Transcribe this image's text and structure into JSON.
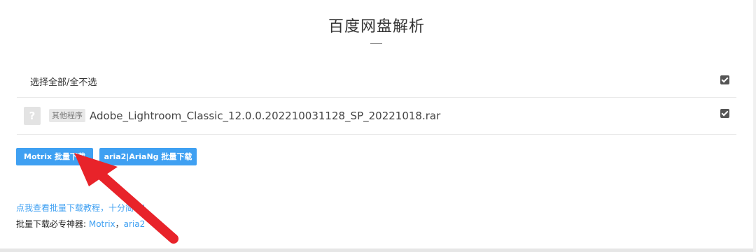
{
  "page": {
    "title": "百度网盘解析"
  },
  "selection": {
    "select_all_label": "选择全部/全不选",
    "select_all_checked": true
  },
  "files": [
    {
      "icon": "unknown-file-icon",
      "icon_glyph": "?",
      "tag": "其他程序",
      "name": "Adobe_Lightroom_Classic_12.0.0.202210031128_SP_20221018.rar",
      "checked": true
    }
  ],
  "buttons": {
    "motrix": "Motrix 批量下载",
    "aria": "aria2|AriaNg 批量下载"
  },
  "footer": {
    "tutorial_link": "点我查看批量下载教程，十分简单!",
    "tools_prefix": "批量下载必专神器: ",
    "tool_motrix": "Motrix",
    "separator": "，",
    "tool_aria": "aria2"
  },
  "colors": {
    "accent": "#3fa0f2",
    "annotation_arrow": "#e8232a"
  }
}
